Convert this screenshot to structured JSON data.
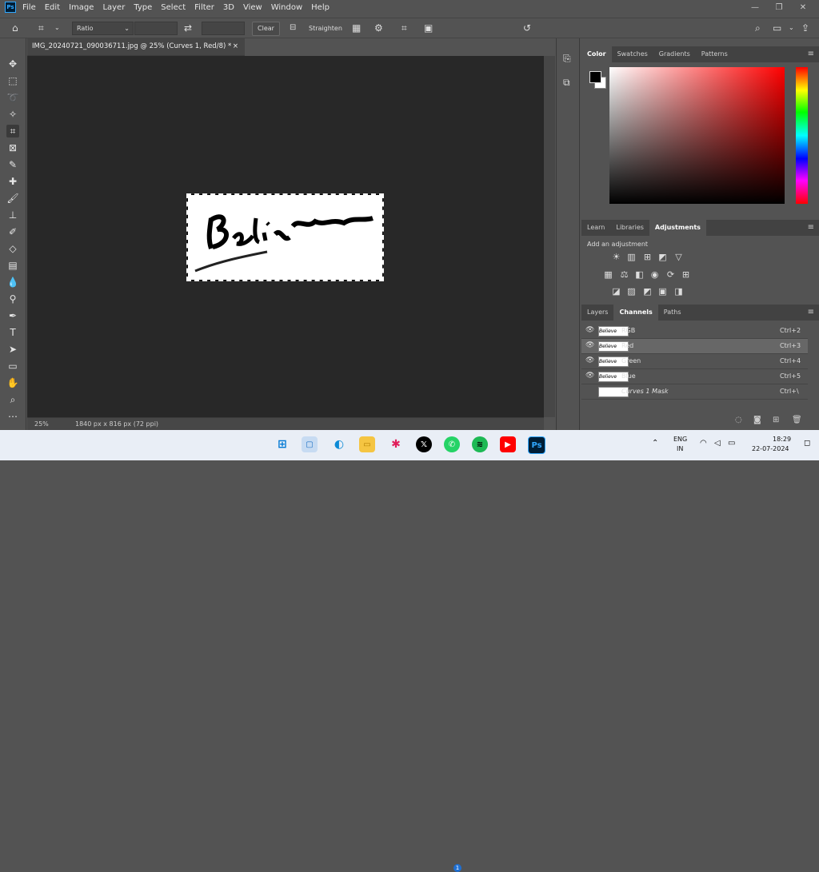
{
  "menubar": {
    "logo": "Ps",
    "items": [
      "File",
      "Edit",
      "Image",
      "Layer",
      "Type",
      "Select",
      "Filter",
      "3D",
      "View",
      "Window",
      "Help"
    ],
    "controls": [
      "—",
      "❐",
      "✕"
    ]
  },
  "options": {
    "ratio_label": "Ratio",
    "clear_label": "Clear",
    "straighten_label": "Straighten"
  },
  "document": {
    "tab_title": "IMG_20240721_090036711.jpg @ 25% (Curves 1, Red/8) *",
    "close_label": "×",
    "zoom": "25%",
    "info": "1840 px x 816 px (72 ppi)",
    "image_text": "Believe"
  },
  "color_panel": {
    "tabs": [
      "Color",
      "Swatches",
      "Gradients",
      "Patterns"
    ],
    "fg_color": "#000000",
    "bg_color": "#ffffff"
  },
  "adjust_panel": {
    "tabs": [
      "Learn",
      "Libraries",
      "Adjustments"
    ],
    "subtitle": "Add an adjustment"
  },
  "channels_panel": {
    "tabs": [
      "Layers",
      "Channels",
      "Paths"
    ],
    "rows": [
      {
        "name": "RGB",
        "key": "Ctrl+2",
        "selected": false,
        "eye": "👁"
      },
      {
        "name": "Red",
        "key": "Ctrl+3",
        "selected": true,
        "eye": "👁"
      },
      {
        "name": "Green",
        "key": "Ctrl+4",
        "selected": false,
        "eye": "👁"
      },
      {
        "name": "Blue",
        "key": "Ctrl+5",
        "selected": false,
        "eye": "👁"
      },
      {
        "name": "Curves 1 Mask",
        "key": "Ctrl+\\",
        "selected": false,
        "eye": ""
      }
    ],
    "thumb_text": "Believe"
  },
  "taskbar": {
    "lang": "ENG",
    "region": "IN",
    "time": "18:29",
    "date": "22-07-2024",
    "whatsapp_badge": "1",
    "ps_label": "Ps"
  },
  "colors": {
    "canvas_bg": "#282828",
    "panel_bg": "#535353",
    "ps_blue": "#31a8ff"
  }
}
